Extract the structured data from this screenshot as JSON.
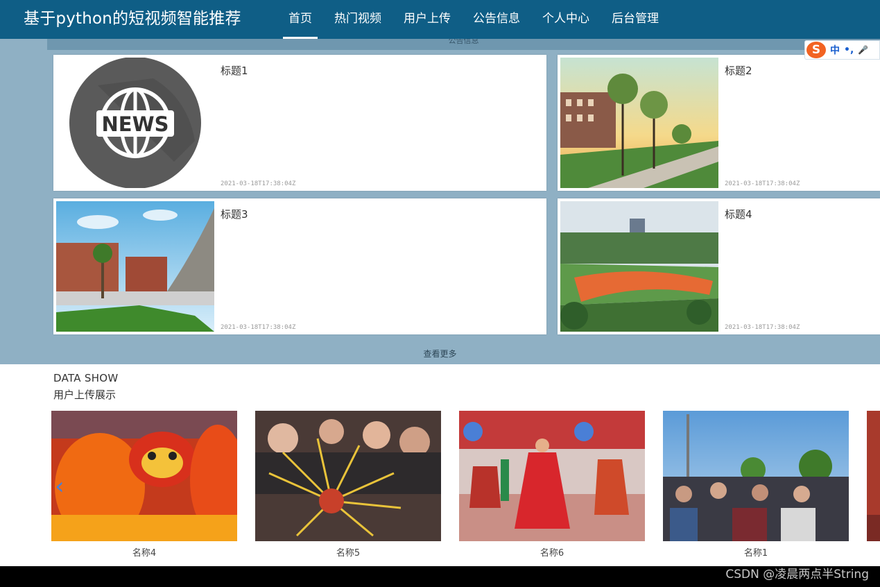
{
  "nav": {
    "brand": "基于python的短视频智能推荐",
    "items": [
      {
        "label": "首页",
        "active": true
      },
      {
        "label": "热门视频"
      },
      {
        "label": "用户上传"
      },
      {
        "label": "公告信息"
      },
      {
        "label": "个人中心"
      },
      {
        "label": "后台管理"
      }
    ]
  },
  "news": {
    "header_text": "公告信息",
    "items": [
      {
        "title": "标题1",
        "time": "2021-03-18T17:38:04Z"
      },
      {
        "title": "标题2",
        "time": "2021-03-18T17:38:04Z"
      },
      {
        "title": "标题3",
        "time": "2021-03-18T17:38:04Z"
      },
      {
        "title": "标题4",
        "time": "2021-03-18T17:38:04Z"
      }
    ],
    "more": "查看更多"
  },
  "data_show": {
    "title": "DATA SHOW",
    "subtitle": "用户上传展示",
    "items": [
      {
        "name": "名称4"
      },
      {
        "name": "名称5"
      },
      {
        "name": "名称6"
      },
      {
        "name": "名称1"
      }
    ]
  },
  "news_badge": "NEWS",
  "ime": {
    "logo": "S",
    "lang": "中",
    "punct": "•,",
    "mic": "🎤"
  },
  "watermark": "CSDN @凌晨两点半String",
  "colors": {
    "nav": "#0f5e86",
    "section_bg": "#8fb0c4",
    "accent": "#4a7fd6"
  }
}
